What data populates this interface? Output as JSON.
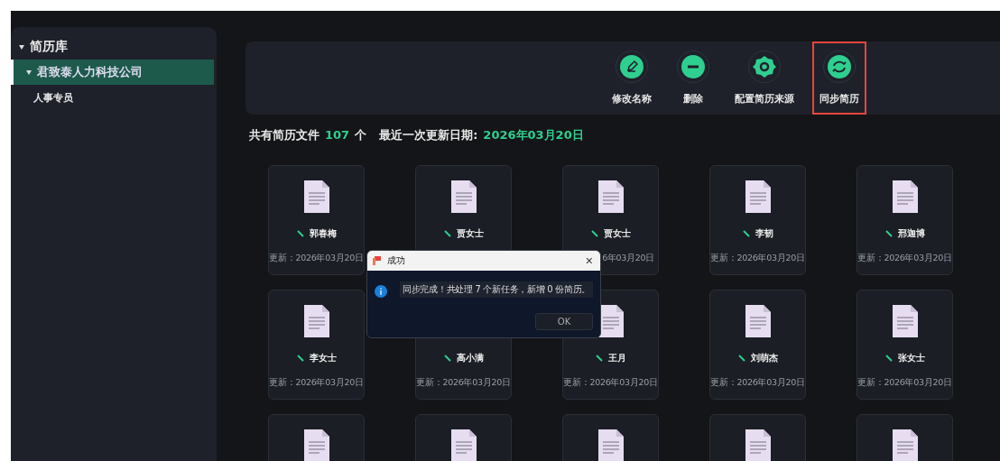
{
  "sidebar": {
    "tree": [
      {
        "label": "简历库",
        "expanded": true,
        "selected": false,
        "children": [
          {
            "label": "君致泰人力科技公司",
            "expanded": true,
            "selected": true,
            "children": [
              {
                "label": "人事专员",
                "selected": false
              }
            ]
          }
        ]
      }
    ]
  },
  "toolbar": {
    "actions": [
      {
        "kind": "edit",
        "label": "修改名称",
        "highlighted": false
      },
      {
        "kind": "delete",
        "label": "删除",
        "highlighted": false
      },
      {
        "kind": "settings",
        "label": "配置简历来源",
        "highlighted": false
      },
      {
        "kind": "sync",
        "label": "同步简历",
        "highlighted": true
      }
    ]
  },
  "summary": {
    "prefix": "共有简历文件",
    "count": "107",
    "unit": "个",
    "date_label": "最近一次更新日期:",
    "date": "2026年03月20日"
  },
  "files": [
    {
      "name": "郭春梅",
      "updated": "更新：2026年03月20日"
    },
    {
      "name": "贾女士"
    },
    {
      "kind": "clipped",
      "name": "贾女士",
      "updated": "6年03月20日"
    },
    {
      "name": "李韧",
      "updated": "更新：2026年03月20日"
    },
    {
      "name": "邢迦博",
      "updated": "更新：2026年03月20日"
    },
    {
      "name": "李女士",
      "updated": "更新：2026年03月20日"
    },
    {
      "name": "高小满",
      "updated": "更新：2026年03月20日"
    },
    {
      "name": "王月",
      "updated": "更新：2026年03月20日"
    },
    {
      "name": "刘萌杰",
      "updated": "更新：2026年03月20日"
    },
    {
      "name": "张女士",
      "updated": "更新：2026年03月20日"
    },
    {
      "kind": "partial"
    },
    {
      "kind": "partial"
    },
    {
      "kind": "partial"
    },
    {
      "kind": "partial"
    },
    {
      "kind": "partial"
    }
  ],
  "dialog": {
    "title": "成功",
    "message": "同步完成！共处理 7 个新任务，新增 0 份简历。",
    "button": "OK",
    "close": "×"
  }
}
